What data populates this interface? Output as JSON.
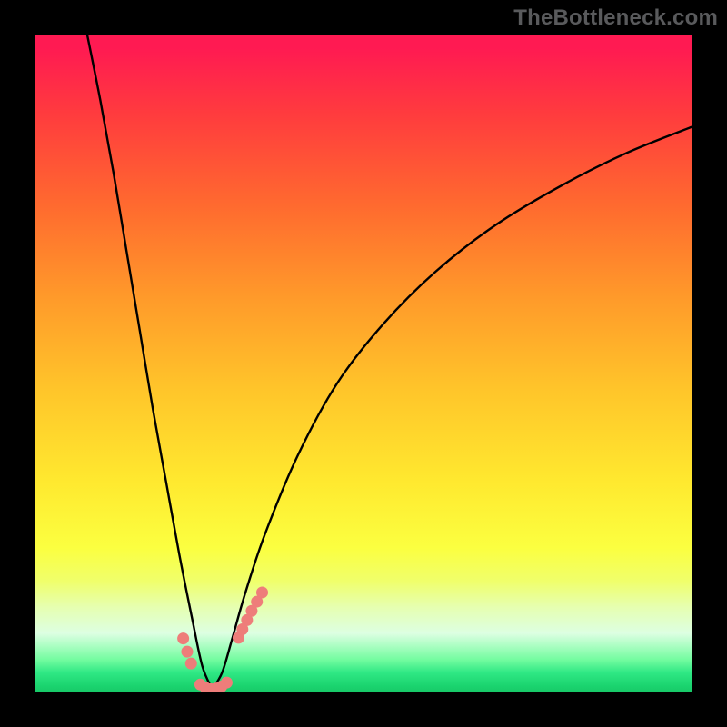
{
  "watermark": "TheBottleneck.com",
  "colors": {
    "frame": "#000000",
    "gradient_top": "#ff1a52",
    "gradient_bottom": "#17c867",
    "curve": "#000000",
    "marker": "#ee7d7a"
  },
  "chart_data": {
    "type": "line",
    "title": "",
    "xlabel": "",
    "ylabel": "",
    "xlim": [
      0,
      100
    ],
    "ylim": [
      0,
      100
    ],
    "grid": false,
    "legend": false,
    "annotations": [],
    "note": "No numeric axis ticks are shown; x and y are normalized 0–100 estimates read from the V-shaped bottleneck curve. Vertex x≈27, y≈0.",
    "series": [
      {
        "name": "left-branch",
        "x": [
          8.0,
          10.0,
          12.0,
          14.0,
          16.0,
          18.0,
          20.0,
          22.0,
          24.0,
          25.5,
          27.0
        ],
        "y": [
          100.0,
          90.0,
          79.0,
          67.0,
          55.0,
          43.0,
          32.0,
          21.0,
          11.0,
          4.0,
          0.5
        ]
      },
      {
        "name": "right-branch",
        "x": [
          27.0,
          28.5,
          30.0,
          32.0,
          35.0,
          40.0,
          46.0,
          53.0,
          61.0,
          70.0,
          80.0,
          90.0,
          100.0
        ],
        "y": [
          0.5,
          3.0,
          8.0,
          15.0,
          24.0,
          36.0,
          47.0,
          56.0,
          64.0,
          71.0,
          77.0,
          82.0,
          86.0
        ]
      }
    ],
    "markers": [
      {
        "name": "left-marker",
        "x": [
          22.6,
          23.2,
          23.8
        ],
        "y": [
          8.2,
          6.2,
          4.4
        ]
      },
      {
        "name": "bottom-marker",
        "x": [
          25.2,
          26.0,
          26.8,
          27.6,
          28.4,
          29.2
        ],
        "y": [
          1.2,
          0.7,
          0.5,
          0.6,
          0.9,
          1.5
        ]
      },
      {
        "name": "right-marker",
        "x": [
          31.0,
          31.6,
          32.3,
          33.0,
          33.8,
          34.6
        ],
        "y": [
          8.3,
          9.6,
          11.0,
          12.4,
          13.8,
          15.2
        ]
      }
    ]
  }
}
